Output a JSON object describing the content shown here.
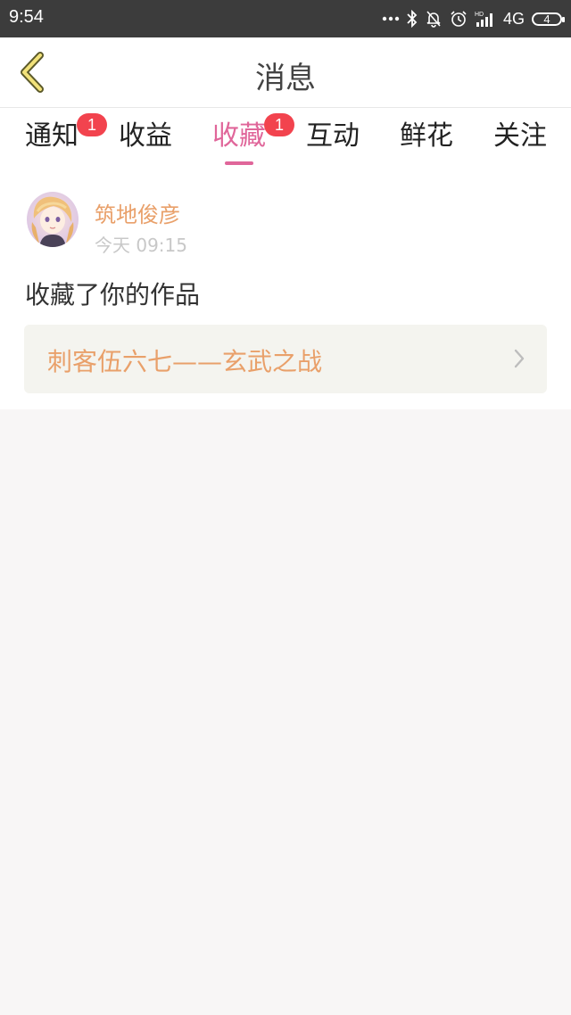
{
  "status_bar": {
    "time": "9:54",
    "network": "4G",
    "battery_level": "4",
    "icons": [
      "dots-icon",
      "bluetooth-icon",
      "bell-off-icon",
      "alarm-icon",
      "signal-icon",
      "battery-icon"
    ]
  },
  "nav": {
    "title": "消息",
    "back_icon": "chevron-left-icon"
  },
  "tabs": [
    {
      "label": "通知",
      "badge": "1",
      "active": false
    },
    {
      "label": "收益",
      "badge": "",
      "active": false
    },
    {
      "label": "收藏",
      "badge": "1",
      "active": true
    },
    {
      "label": "互动",
      "badge": "",
      "active": false
    },
    {
      "label": "鲜花",
      "badge": "",
      "active": false
    },
    {
      "label": "关注",
      "badge": "",
      "active": false
    }
  ],
  "message": {
    "user_name": "筑地俊彦",
    "time": "今天 09:15",
    "action": "收藏了你的作品",
    "work_title": "刺客伍六七——玄武之战"
  },
  "colors": {
    "accent": "#e0669a",
    "badge": "#f2434e",
    "highlight_text": "#e9a06a",
    "status_bar": "#3c3c3c",
    "background": "#f8f6f6"
  }
}
